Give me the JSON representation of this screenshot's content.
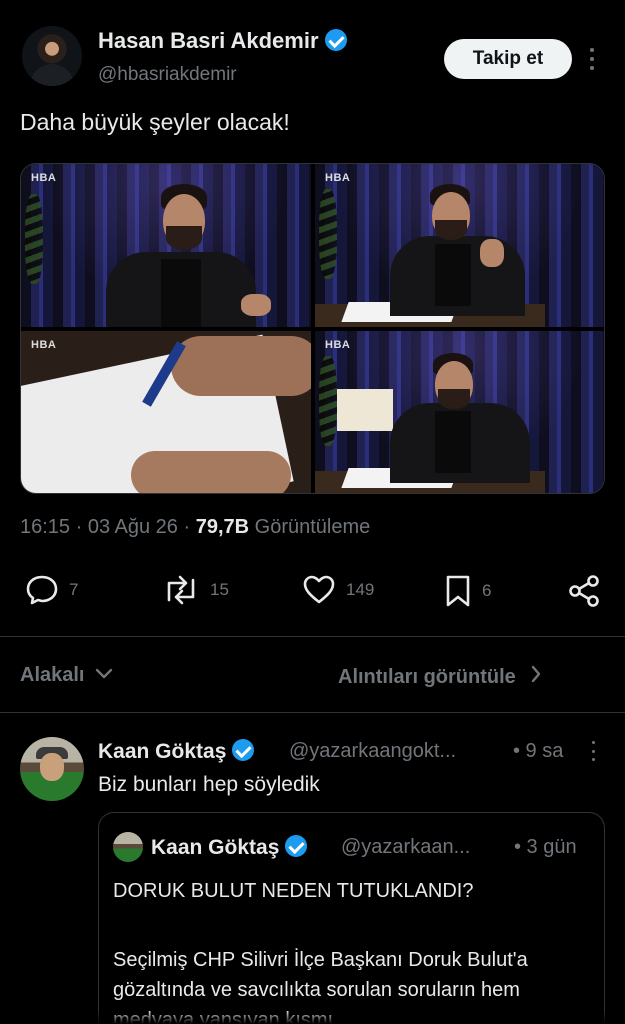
{
  "author": {
    "name": "Hasan Basri Akdemir",
    "handle": "@hbasriakdemir",
    "follow_label": "Takip et"
  },
  "tweet": {
    "text": "Daha büyük şeyler olacak!",
    "media_logo": "HBA",
    "time": "16:15",
    "date": "03 Ağu 26",
    "views_count": "79,7B",
    "views_label": "Görüntüleme"
  },
  "actions": {
    "replies": "7",
    "reposts": "15",
    "likes": "149",
    "bookmarks": "6"
  },
  "tabs": {
    "related_label": "Alakalı",
    "quotes_label": "Alıntıları görüntüle"
  },
  "reply": {
    "name": "Kaan Göktaş",
    "handle": "@yazarkaangokt...",
    "time": "• 9 sa",
    "text": "Biz bunları hep söyledik",
    "quote": {
      "name": "Kaan Göktaş",
      "handle": "@yazarkaan...",
      "time": "• 3 gün",
      "title": "DORUK BULUT NEDEN TUTUKLANDI?",
      "body": "Seçilmiş CHP Silivri İlçe Başkanı Doruk Bulut'a gözaltında ve savcılıkta sorulan soruların hem medyaya yansıyan kısmı"
    }
  },
  "colors": {
    "background": "#000000",
    "text": "#e7e9ea",
    "muted": "#71767b",
    "verified": "#1d9bf0",
    "divider": "#2f3336"
  }
}
